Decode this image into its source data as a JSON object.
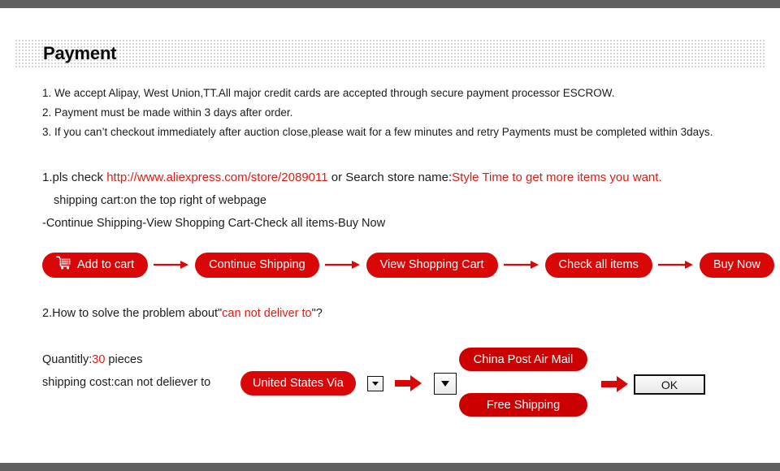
{
  "page": {
    "title": "Payment",
    "accent_red": "#d90707",
    "link_red": "#e01b12",
    "rail_color": "#616161"
  },
  "terms": {
    "line1": "1. We accept Alipay, West Union,TT.All major credit cards are accepted through secure payment processor ESCROW.",
    "line2": "2. Payment must be made within 3 days after order.",
    "line3": "3. If you can’t checkout immediately after auction close,please wait for a few minutes and retry Payments must be completed within 3days."
  },
  "instructions": {
    "step1_prefix": "1.pls check ",
    "store_url": "http://www.aliexpress.com/store/2089011",
    "step1_middle": " or Search store name:",
    "store_name_cta": "Style Time to get more items you want.",
    "step1_sub": "shipping cart:on the top right of webpage",
    "step1_path": "-Continue Shipping-View Shopping Cart-Check all items-Buy Now",
    "step2_prefix": "2.How to solve the problem about\"",
    "step2_red": "can not deliver to",
    "step2_suffix": "\"?"
  },
  "flow": {
    "cart_icon": "shopping-cart-icon",
    "buttons": [
      {
        "label": "Add to cart",
        "has_icon": true
      },
      {
        "label": "Continue Shipping",
        "has_icon": false
      },
      {
        "label": "View Shopping Cart",
        "has_icon": false
      },
      {
        "label": "Check all items",
        "has_icon": false
      },
      {
        "label": "Buy Now",
        "has_icon": false
      }
    ]
  },
  "shipping": {
    "quantity_label": "Quantitly:",
    "quantity_value": "30",
    "quantity_unit": " pieces",
    "cost_label": "shipping cost:can not deliever to",
    "country_pill": "United States Via",
    "options": [
      "China Post Air Mail",
      "Free Shipping"
    ],
    "ok_label": "OK"
  }
}
